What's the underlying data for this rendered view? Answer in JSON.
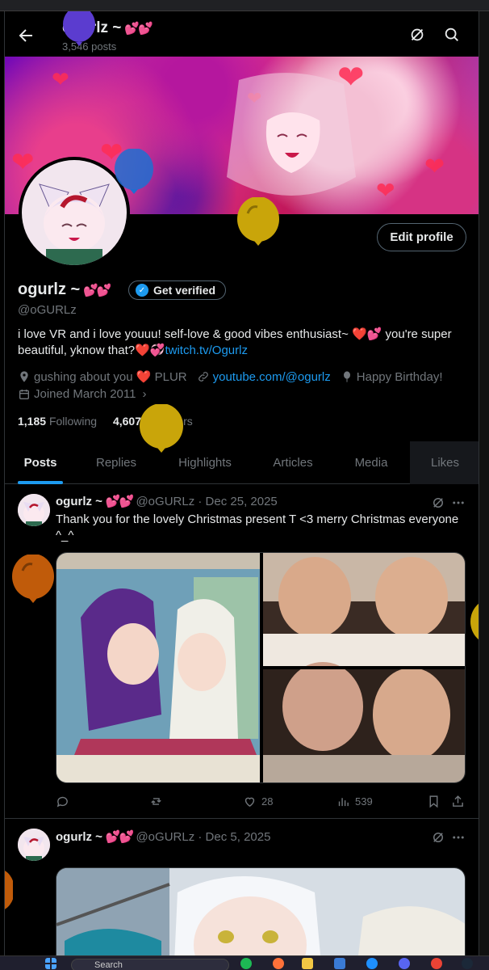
{
  "header": {
    "name": "ogurlz ~",
    "name_hearts": "💕💕",
    "post_count": "3,546 posts"
  },
  "profile": {
    "edit_label": "Edit profile",
    "name": "ogurlz ~",
    "name_hearts": "💕💕",
    "verify_label": "Get verified",
    "handle": "@oGURLz",
    "bio_text": "i love VR and i love youuu! self-love & good vibes enthusiast~ ❤️💕 you're super beautiful, yknow that?❤️💞",
    "bio_link": "twitch.tv/Ogurlz",
    "meta": {
      "location": "gushing about you ❤️ PLUR",
      "website": "youtube.com/@ogurlz",
      "birthday": "Happy Birthday!",
      "joined": "Joined March 2011"
    },
    "following_count": "1,185",
    "following_label": "Following",
    "followers_count": "4,607",
    "followers_label": "Followers"
  },
  "tabs": [
    {
      "label": "Posts"
    },
    {
      "label": "Replies"
    },
    {
      "label": "Highlights"
    },
    {
      "label": "Articles"
    },
    {
      "label": "Media"
    },
    {
      "label": "Likes"
    }
  ],
  "active_tab": "Posts",
  "posts": [
    {
      "name": "ogurlz ~",
      "hearts": "💕💕",
      "handle": "@oGURLz",
      "date": "Dec 25, 2025",
      "text": "Thank you for the lovely Christmas present T <3 merry Christmas everyone ^_^",
      "replies": "",
      "reposts": "",
      "likes": "28",
      "views": "539"
    },
    {
      "name": "ogurlz ~",
      "hearts": "💕💕",
      "handle": "@oGURLz",
      "date": "Dec 5, 2025"
    }
  ],
  "taskbar": {
    "search_placeholder": "Search"
  },
  "colors": {
    "accent": "#1d9bf0",
    "background": "#000000",
    "text": "#e7e9ea",
    "muted": "#71767b",
    "heart": "#f91880"
  },
  "icons": [
    "back-arrow-icon",
    "grok-icon",
    "search-icon",
    "location-icon",
    "link-icon",
    "balloon-icon",
    "calendar-icon",
    "reply-icon",
    "repost-icon",
    "like-icon",
    "views-icon",
    "bookmark-icon",
    "share-icon",
    "more-icon"
  ]
}
